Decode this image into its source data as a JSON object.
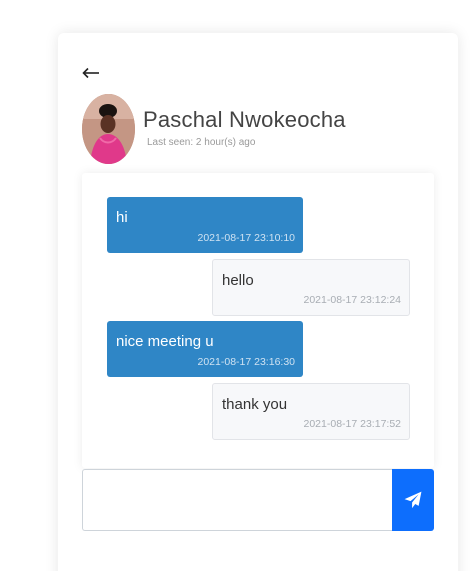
{
  "header": {
    "back_icon": "left-arrow-icon",
    "contact_name": "Paschal Nwokeocha",
    "last_seen": "Last seen: 2 hour(s) ago"
  },
  "messages": [
    {
      "direction": "sent",
      "text": "hi",
      "time": "2021-08-17 23:10:10"
    },
    {
      "direction": "received",
      "text": "hello",
      "time": "2021-08-17 23:12:24"
    },
    {
      "direction": "sent",
      "text": "nice meeting u",
      "time": "2021-08-17 23:16:30"
    },
    {
      "direction": "received",
      "text": "thank you",
      "time": "2021-08-17 23:17:52"
    }
  ],
  "composer": {
    "placeholder": "",
    "value": "",
    "send_icon": "paper-plane-icon"
  },
  "colors": {
    "sent_bubble": "#2f86c6",
    "received_bubble": "#f7f8fa",
    "send_button": "#0d6efd"
  }
}
